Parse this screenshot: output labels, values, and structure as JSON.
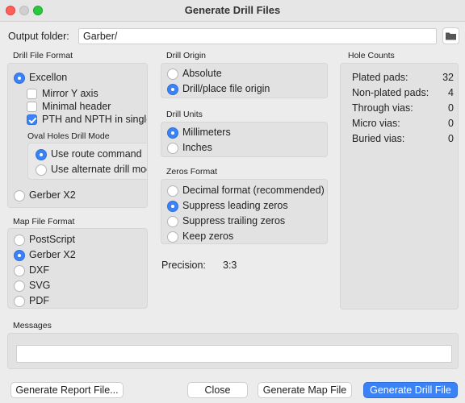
{
  "window": {
    "title": "Generate Drill Files"
  },
  "output": {
    "label": "Output folder:",
    "value": "Garber/",
    "browse_icon": "folder-icon"
  },
  "drill_format": {
    "header": "Drill File Format",
    "excellon": "Excellon",
    "mirror_y": "Mirror Y axis",
    "minimal_header": "Minimal header",
    "pth_npth": "PTH and NPTH in single file",
    "oval_header": "Oval Holes Drill Mode",
    "use_route": "Use route command",
    "use_alternate": "Use alternate drill mode",
    "gerber_x2": "Gerber X2"
  },
  "map_format": {
    "header": "Map File Format",
    "options": [
      "PostScript",
      "Gerber X2",
      "DXF",
      "SVG",
      "PDF"
    ]
  },
  "drill_origin": {
    "header": "Drill Origin",
    "options": [
      "Absolute",
      "Drill/place file origin"
    ]
  },
  "drill_units": {
    "header": "Drill Units",
    "options": [
      "Millimeters",
      "Inches"
    ]
  },
  "zeros_format": {
    "header": "Zeros Format",
    "options": [
      "Decimal format (recommended)",
      "Suppress leading zeros",
      "Suppress trailing zeros",
      "Keep zeros"
    ]
  },
  "precision": {
    "label": "Precision:",
    "value": "3:3"
  },
  "hole_counts": {
    "header": "Hole Counts",
    "rows": [
      {
        "label": "Plated pads:",
        "value": "32"
      },
      {
        "label": "Non-plated pads:",
        "value": "4"
      },
      {
        "label": "Through vias:",
        "value": "0"
      },
      {
        "label": "Micro vias:",
        "value": "0"
      },
      {
        "label": "Buried vias:",
        "value": "0"
      }
    ]
  },
  "messages": {
    "header": "Messages",
    "value": ""
  },
  "buttons": {
    "report": "Generate Report File...",
    "close": "Close",
    "map": "Generate Map File",
    "drill": "Generate Drill File"
  }
}
